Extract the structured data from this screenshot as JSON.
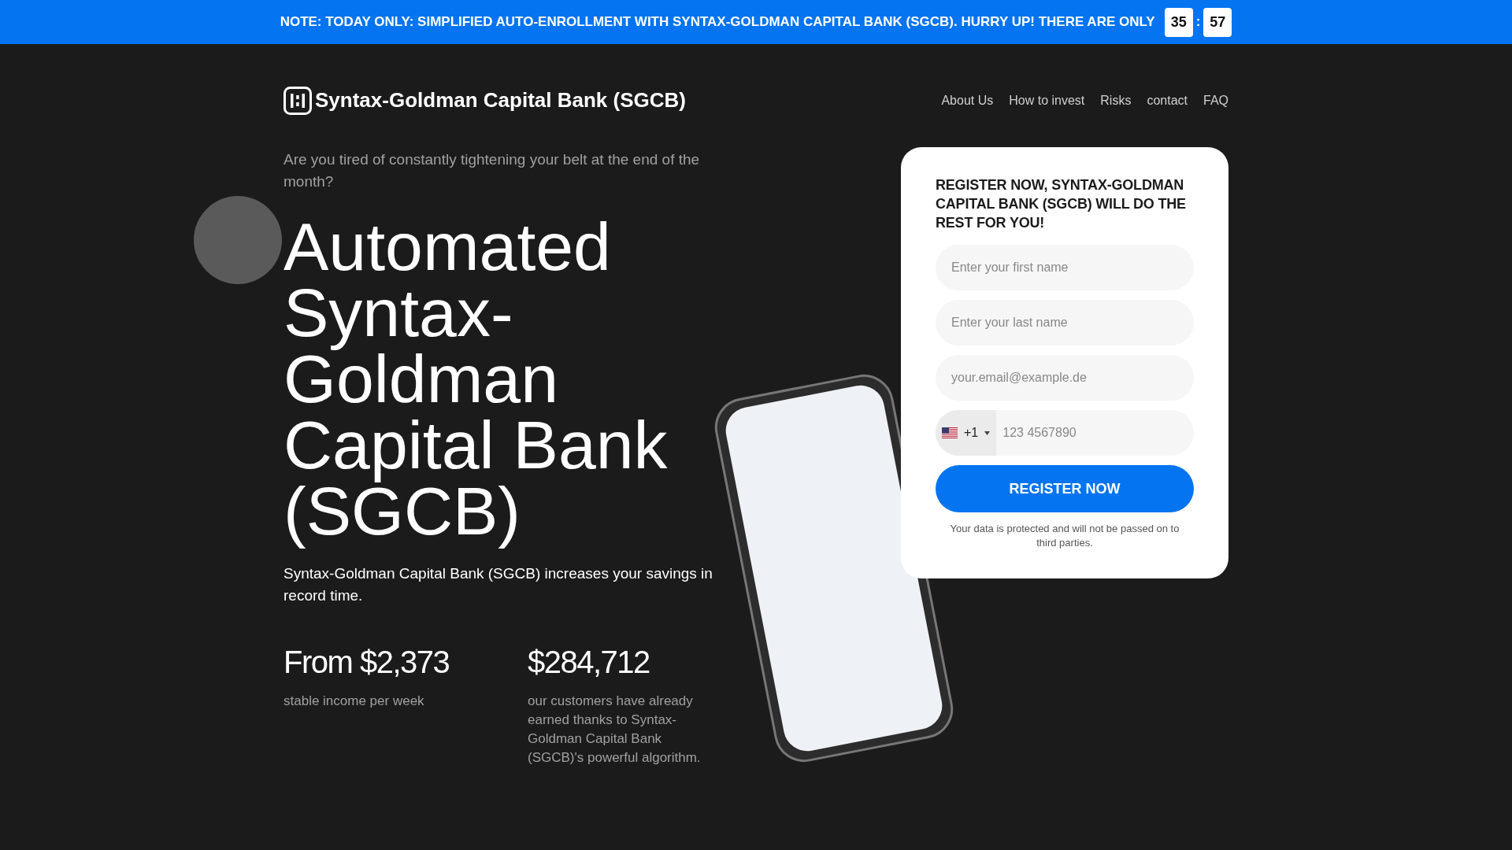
{
  "banner": {
    "text": "NOTE: TODAY ONLY: SIMPLIFIED AUTO-ENROLLMENT WITH SYNTAX-GOLDMAN CAPITAL BANK (SGCB). HURRY UP! THERE ARE ONLY",
    "countdown": [
      "35",
      "57"
    ],
    "separator": ":"
  },
  "header": {
    "logo_text": "Syntax-Goldman Capital Bank (SGCB)",
    "nav": [
      "About Us",
      "How to invest",
      "Risks",
      "contact",
      "FAQ"
    ]
  },
  "hero": {
    "intro": "Are you tired of constantly tightening your belt at the end of the month?",
    "heading": "Automated Syntax-Goldman Capital Bank (SGCB)",
    "subtext": "Syntax-Goldman Capital Bank (SGCB) increases your savings in record time."
  },
  "stats": [
    {
      "value": "From $2,373",
      "caption": "stable income per week"
    },
    {
      "value": "$284,712",
      "caption": "our customers have already earned thanks to Syntax-Goldman Capital Bank (SGCB)'s powerful algorithm."
    }
  ],
  "form": {
    "title": "REGISTER NOW, SYNTAX-GOLDMAN CAPITAL BANK (SGCB) WILL DO THE REST FOR YOU!",
    "fields": [
      {
        "placeholder": "Enter your first name"
      },
      {
        "placeholder": "Enter your last name"
      },
      {
        "placeholder": "your.email@example.de"
      }
    ],
    "phone": {
      "dial_code": "+1",
      "placeholder": "123 4567890"
    },
    "button": "REGISTER NOW",
    "note": "Your data is protected and will not be passed on to third parties."
  }
}
